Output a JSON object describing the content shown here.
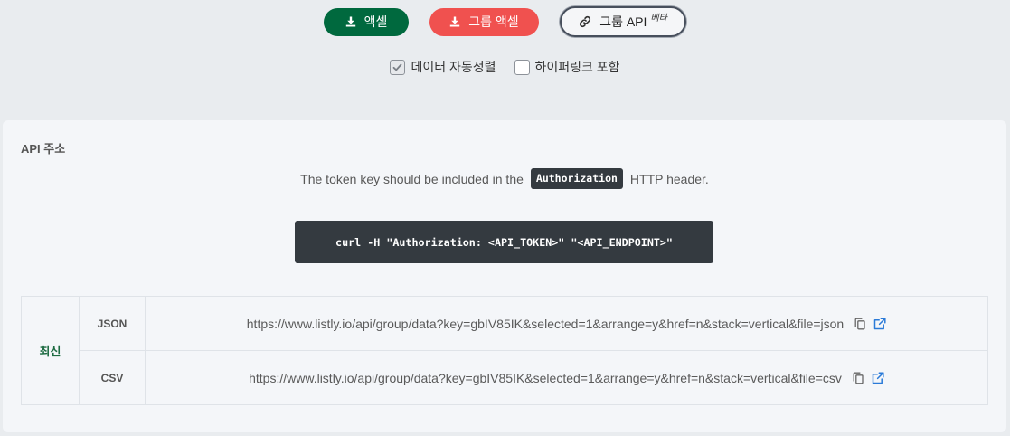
{
  "toolbar": {
    "excel": {
      "label": "액셀",
      "icon": "download-icon",
      "color": "#00693e"
    },
    "group_excel": {
      "label": "그룹 액셀",
      "icon": "download-icon",
      "color": "#f0514f"
    },
    "group_api": {
      "label": "그룹 API",
      "badge": "베타",
      "icon": "link-icon"
    }
  },
  "options": [
    {
      "label": "데이터 자동정렬",
      "checked": true,
      "icon": "check-icon"
    },
    {
      "label": "하이퍼링크 포함",
      "checked": false
    }
  ],
  "api": {
    "title": "API 주소",
    "note": {
      "before": "The token key should be included in the",
      "code": "Authorization",
      "after": "HTTP header."
    },
    "curl_command": "curl -H \"Authorization: <API_TOKEN>\" \"<API_ENDPOINT>\"",
    "endpoints": {
      "version_label": "최신",
      "rows": [
        {
          "format": "JSON",
          "url": "https://www.listly.io/api/group/data?key=gbIV85IK&selected=1&arrange=y&href=n&stack=vertical&file=json",
          "icons": [
            "copy-icon",
            "external-link-icon"
          ]
        },
        {
          "format": "CSV",
          "url": "https://www.listly.io/api/group/data?key=gbIV85IK&selected=1&arrange=y&href=n&stack=vertical&file=csv",
          "icons": [
            "copy-icon",
            "external-link-icon"
          ]
        }
      ],
      "link_color": "#2a7ad8"
    }
  }
}
